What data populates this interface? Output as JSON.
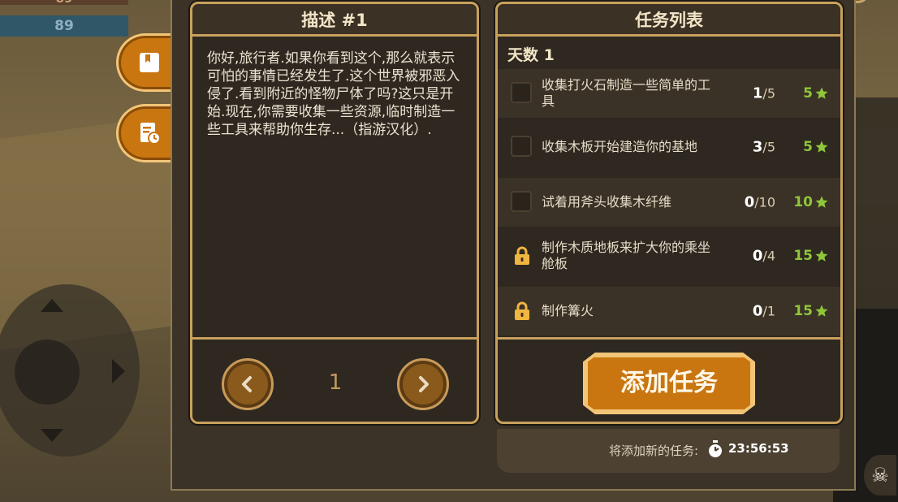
{
  "hud": {
    "top_value_a": "89",
    "top_value_b": "89"
  },
  "description": {
    "title": "描述 #1",
    "text": "你好,旅行者.如果你看到这个,那么就表示可怕的事情已经发生了.这个世界被邪恶入侵了.看到附近的怪物尸体了吗?这只是开始.现在,你需要收集一些资源,临时制造一些工具来帮助你生存...（指游汉化）.",
    "page": "1"
  },
  "quest_list": {
    "title": "任务列表",
    "day_label": "天数 1",
    "quests": [
      {
        "text": "收集打火石制造一些简单的工具",
        "done": "1",
        "total": "/5",
        "reward": "5",
        "locked": false
      },
      {
        "text": "收集木板开始建造你的基地",
        "done": "3",
        "total": "/5",
        "reward": "5",
        "locked": false
      },
      {
        "text": "试着用斧头收集木纤维",
        "done": "0",
        "total": "/10",
        "reward": "10",
        "locked": false
      },
      {
        "text": "制作木质地板来扩大你的乘坐舱板",
        "done": "0",
        "total": "/4",
        "reward": "15",
        "locked": true
      },
      {
        "text": "制作篝火",
        "done": "0",
        "total": "/1",
        "reward": "15",
        "locked": true
      }
    ],
    "add_button": "添加任务"
  },
  "timer": {
    "label": "将添加新的任务:",
    "value": "23:56:53"
  },
  "colors": {
    "accent_orange": "#c97610",
    "frame_gold": "#c8a15c",
    "reward_green": "#8fc63a"
  },
  "icons": [
    "book-icon",
    "quest-log-icon",
    "chevron-left-icon",
    "chevron-right-icon",
    "lock-icon",
    "star-icon",
    "stopwatch-icon"
  ]
}
